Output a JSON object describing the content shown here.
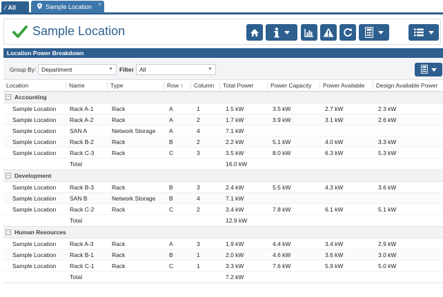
{
  "tabs": {
    "all_label": "All",
    "location_label": "Sample Location",
    "close_glyph": "×"
  },
  "header": {
    "title": "Sample Location",
    "accent": "#2d5f8f",
    "check_color": "#3aa13a"
  },
  "toolbar": {
    "icons": [
      "home-icon",
      "info-icon",
      "chart-icon",
      "warning-icon",
      "refresh-icon",
      "calculator-icon",
      "list-icon"
    ]
  },
  "panel": {
    "title": "Location Power Breakdown"
  },
  "filters": {
    "group_by_label": "Group By:",
    "group_by_value": "Department",
    "filter_label": "Filter",
    "filter_value": "All"
  },
  "columns": [
    "Location",
    "Name",
    "Type",
    "Row",
    "Column",
    "Total Power",
    "Power Capacity",
    "Power Available",
    "Design Available Power"
  ],
  "sort_indicator": "↑",
  "groups": [
    {
      "label": "Accounting",
      "rows": [
        {
          "location": "Sample Location",
          "name": "Rack A-1",
          "type": "Rack",
          "row": "A",
          "column": "1",
          "total": "1.5 kW",
          "capacity": "3.5 kW",
          "available": "2.7 kW",
          "design": "2.3 kW"
        },
        {
          "location": "Sample Location",
          "name": "Rack A-2",
          "type": "Rack",
          "row": "A",
          "column": "2",
          "total": "1.7 kW",
          "capacity": "3.9 kW",
          "available": "3.1 kW",
          "design": "2.6 kW"
        },
        {
          "location": "Sample Location",
          "name": "SAN A",
          "type": "Network Storage",
          "row": "A",
          "column": "4",
          "total": "7.1 kW",
          "capacity": "",
          "available": "",
          "design": ""
        },
        {
          "location": "Sample Location",
          "name": "Rack B-2",
          "type": "Rack",
          "row": "B",
          "column": "2",
          "total": "2.2 kW",
          "capacity": "5.1 kW",
          "available": "4.0 kW",
          "design": "3.3 kW"
        },
        {
          "location": "Sample Location",
          "name": "Rack C-3",
          "type": "Rack",
          "row": "C",
          "column": "3",
          "total": "3.5 kW",
          "capacity": "8.0 kW",
          "available": "6.3 kW",
          "design": "5.3 kW"
        }
      ],
      "total_label": "Total",
      "total_value": "16.0 kW"
    },
    {
      "label": "Development",
      "rows": [
        {
          "location": "Sample Location",
          "name": "Rack B-3",
          "type": "Rack",
          "row": "B",
          "column": "3",
          "total": "2.4 kW",
          "capacity": "5.5 kW",
          "available": "4.3 kW",
          "design": "3.6 kW"
        },
        {
          "location": "Sample Location",
          "name": "SAN B",
          "type": "Network Storage",
          "row": "B",
          "column": "4",
          "total": "7.1 kW",
          "capacity": "",
          "available": "",
          "design": ""
        },
        {
          "location": "Sample Location",
          "name": "Rack C-2",
          "type": "Rack",
          "row": "C",
          "column": "2",
          "total": "3.4 kW",
          "capacity": "7.8 kW",
          "available": "6.1 kW",
          "design": "5.1 kW"
        }
      ],
      "total_label": "Total",
      "total_value": "12.9 kW"
    },
    {
      "label": "Human Resources",
      "rows": [
        {
          "location": "Sample Location",
          "name": "Rack A-3",
          "type": "Rack",
          "row": "A",
          "column": "3",
          "total": "1.9 kW",
          "capacity": "4.4 kW",
          "available": "3.4 kW",
          "design": "2.9 kW"
        },
        {
          "location": "Sample Location",
          "name": "Rack B-1",
          "type": "Rack",
          "row": "B",
          "column": "1",
          "total": "2.0 kW",
          "capacity": "4.6 kW",
          "available": "3.6 kW",
          "design": "3.0 kW"
        },
        {
          "location": "Sample Location",
          "name": "Rack C-1",
          "type": "Rack",
          "row": "C",
          "column": "1",
          "total": "3.3 kW",
          "capacity": "7.6 kW",
          "available": "5.9 kW",
          "design": "5.0 kW"
        }
      ],
      "total_label": "Total",
      "total_value": "7.2 kW"
    }
  ]
}
